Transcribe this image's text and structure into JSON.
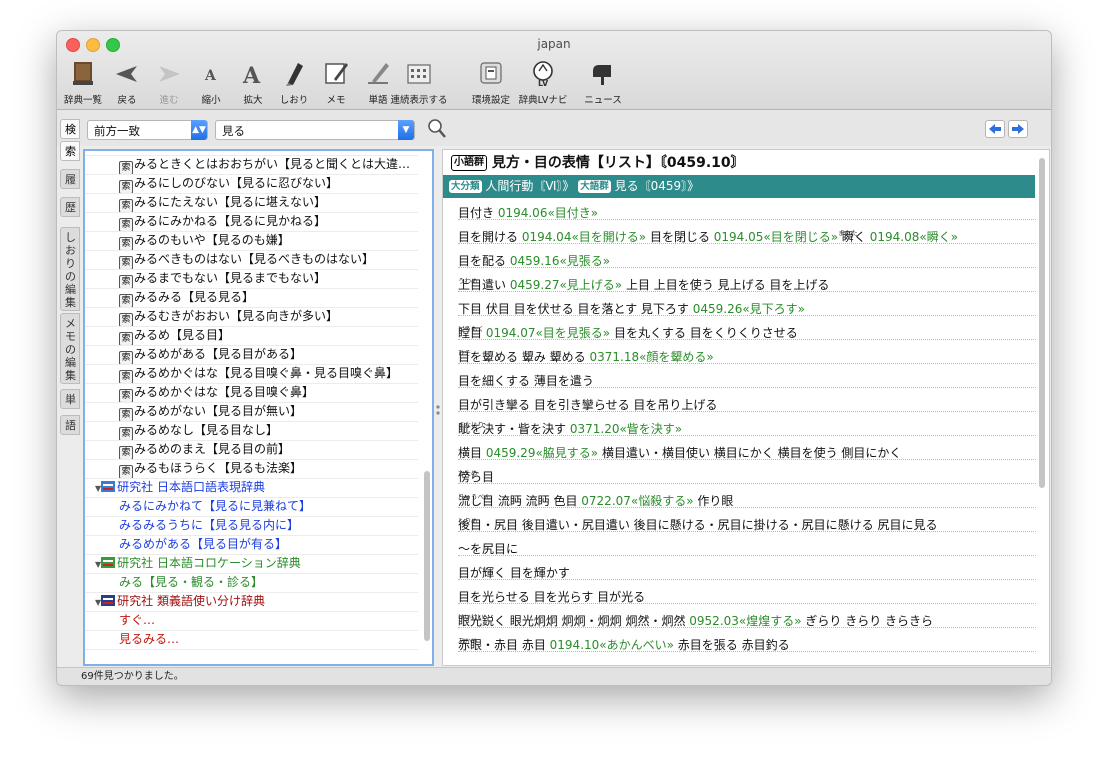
{
  "window": {
    "title": "japan"
  },
  "toolbar": [
    {
      "label": "辞典一覧",
      "icon": "books-icon"
    },
    {
      "label": "戻る",
      "icon": "back-arrow-icon"
    },
    {
      "label": "進む",
      "icon": "forward-arrow-icon"
    },
    {
      "label": "縮小",
      "icon": "font-smaller-icon"
    },
    {
      "label": "拡大",
      "icon": "font-larger-icon"
    },
    {
      "label": "しおり",
      "icon": "bookmark-pen-icon"
    },
    {
      "label": "メモ",
      "icon": "memo-icon"
    },
    {
      "label": "単語",
      "icon": "word-pen-icon"
    },
    {
      "label": "連続表示する",
      "icon": "calendar-grid-icon"
    },
    {
      "label": "環境設定",
      "icon": "settings-icon"
    },
    {
      "label": "辞典LVナビ",
      "icon": "lv-navi-icon"
    },
    {
      "label": "ニュース",
      "icon": "mailbox-icon"
    }
  ],
  "search": {
    "mode": "前方一致",
    "query": "見る"
  },
  "side_tabs": [
    "検",
    "索",
    "履",
    "歴",
    "しおりの編集",
    "メモの編集",
    "単",
    "語"
  ],
  "results": {
    "items": [
      "みるときくとはおおちがい【見ると聞くとは大違…",
      "みるにしのびない【見るに忍びない】",
      "みるにたえない【見るに堪えない】",
      "みるにみかねる【見るに見かねる】",
      "みるのもいや【見るのも嫌】",
      "みるべきものはない【見るべきものはない】",
      "みるまでもない【見るまでもない】",
      "みるみる【見る見る】",
      "みるむきがおおい【見る向きが多い】",
      "みるめ【見る目】",
      "みるめがある【見る目がある】",
      "みるめかぐはな【見る目嗅ぐ鼻・見る目嗅ぐ鼻】",
      "みるめかぐはな【見る目嗅ぐ鼻】",
      "みるめがない【見る目が無い】",
      "みるめなし【見る目なし】",
      "みるめのまえ【見る目の前】",
      "みるもほうらく【見るも法楽】"
    ],
    "key_mark": "索",
    "dict1": {
      "name": "研究社 日本語口語表現辞典",
      "entries": [
        "みるにみかねて【見るに見兼ねて】",
        "みるみるうちに【見る見る内に】",
        "みるめがある【見る目が有る】"
      ]
    },
    "dict2": {
      "name": "研究社 日本語コロケーション辞典",
      "entries": [
        "みる【見る・観る・診る】"
      ]
    },
    "dict3": {
      "name": "研究社 類義語使い分け辞典",
      "entries": [
        "すぐ…",
        "見るみる…"
      ]
    }
  },
  "article": {
    "badge": "小語群",
    "heading": "見方・目の表情【リスト】〘0459.10〙",
    "cat1_badge": "大分類",
    "cat1": "人間行動〘Ⅵ〙》",
    "cat2_badge": "大語群",
    "cat2": "見る〘0459〙》",
    "lines": [
      [
        {
          "t": "目付き "
        },
        {
          "t": "0194.06«目付き»",
          "g": true
        }
      ],
      [
        {
          "t": "目を開ける "
        },
        {
          "t": "0194.04«目を開ける»",
          "g": true
        },
        {
          "t": " 目を閉じる "
        },
        {
          "t": "0194.05«目を閉じる»",
          "g": true
        },
        {
          "t": " 瞬く",
          "rb": "またた"
        },
        {
          "t": " "
        },
        {
          "t": "0194.08«瞬く»",
          "g": true
        }
      ],
      [
        {
          "t": "目を配る "
        },
        {
          "t": "0459.16«見張る»",
          "g": true
        }
      ],
      [
        {
          "t": "上目遣い",
          "rb": "うわめ"
        },
        {
          "t": " "
        },
        {
          "t": "0459.27«見上げる»",
          "g": true
        },
        {
          "t": " 上目 上目を使う 見上げる 目を上げる"
        }
      ],
      [
        {
          "t": "下目 伏目 目を伏せる 目を落とす 見下ろす "
        },
        {
          "t": "0459.26«見下ろす»",
          "g": true
        }
      ],
      [
        {
          "t": "瞠目",
          "rb": "どうもく"
        },
        {
          "t": " "
        },
        {
          "t": "0194.07«目を見張る»",
          "g": true
        },
        {
          "t": " 目を丸くする 目をくりくりさせる"
        }
      ],
      [
        {
          "t": "目を顰める 顰み 顰める",
          "rb": "ひそ"
        },
        {
          "t": " "
        },
        {
          "t": "0371.18«顔を顰める»",
          "g": true
        }
      ],
      [
        {
          "t": "目を細くする 薄目を遣う"
        }
      ],
      [
        {
          "t": "目が引き攣る 目を引き攣らせる 目を吊り上げる"
        }
      ],
      [
        {
          "t": "眦を決す・眥を決す",
          "rb": "まなじり"
        },
        {
          "t": " "
        },
        {
          "t": "0371.20«眥を決す»",
          "g": true
        }
      ],
      [
        {
          "t": "横目 "
        },
        {
          "t": "0459.29«脇見する»",
          "g": true
        },
        {
          "t": " 横目遣い・横目使い 横目にかく 横目を使う 側目にかく"
        }
      ],
      [
        {
          "t": "傍ら目",
          "rb": "かため"
        }
      ],
      [
        {
          "t": "流し目 流眄 流眄",
          "rb": "りゅうべん"
        },
        {
          "t": " 色目 "
        },
        {
          "t": "0722.07«悩殺する»",
          "g": true
        },
        {
          "t": " 作り眼"
        }
      ],
      [
        {
          "t": "後目・尻目 後目遣い・尻目遣い 後目に懸ける・尻目に掛ける・尻目に懸ける 尻目に見る",
          "rb": "しりめ"
        }
      ],
      [
        {
          "t": "〜を尻目に"
        }
      ],
      [
        {
          "t": "目が輝く 目を輝かす"
        }
      ],
      [
        {
          "t": "目を光らせる 目を光らす 目が光る"
        }
      ],
      [
        {
          "t": "眼光鋭く 眼光炯炯 炯炯・炯炯 炯然・炯然",
          "rb": "けいけい"
        },
        {
          "t": " "
        },
        {
          "t": "0952.03«煌煌する»",
          "g": true
        },
        {
          "t": " ぎらり きらり きらきら"
        }
      ],
      [
        {
          "t": "赤眼・赤目 赤目",
          "rb": "あかめ"
        },
        {
          "t": " "
        },
        {
          "t": "0194.10«あかんべい»",
          "g": true
        },
        {
          "t": " 赤目を張る 赤目釣る"
        }
      ]
    ]
  },
  "status": "69件見つかりました。"
}
